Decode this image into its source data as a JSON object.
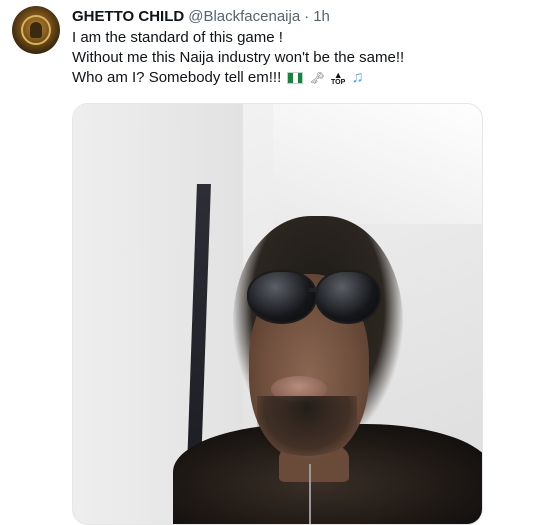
{
  "tweet": {
    "author_name": "GHETTO CHILD",
    "handle": "@Blackfacenaija",
    "separator": "·",
    "time": "1h",
    "lines": [
      "I am the standard of this game !",
      "Without me this Naija industry won't be the same!!",
      "Who am I? Somebody tell em!!!"
    ],
    "emoji_top_label": "TOP",
    "emoji_names": [
      "nigeria-flag",
      "key",
      "top-arrow",
      "musical-note"
    ],
    "media_description": "selfie-photo"
  },
  "colors": {
    "text": "#0f1419",
    "secondary_text": "#536471",
    "background": "#ffffff"
  }
}
